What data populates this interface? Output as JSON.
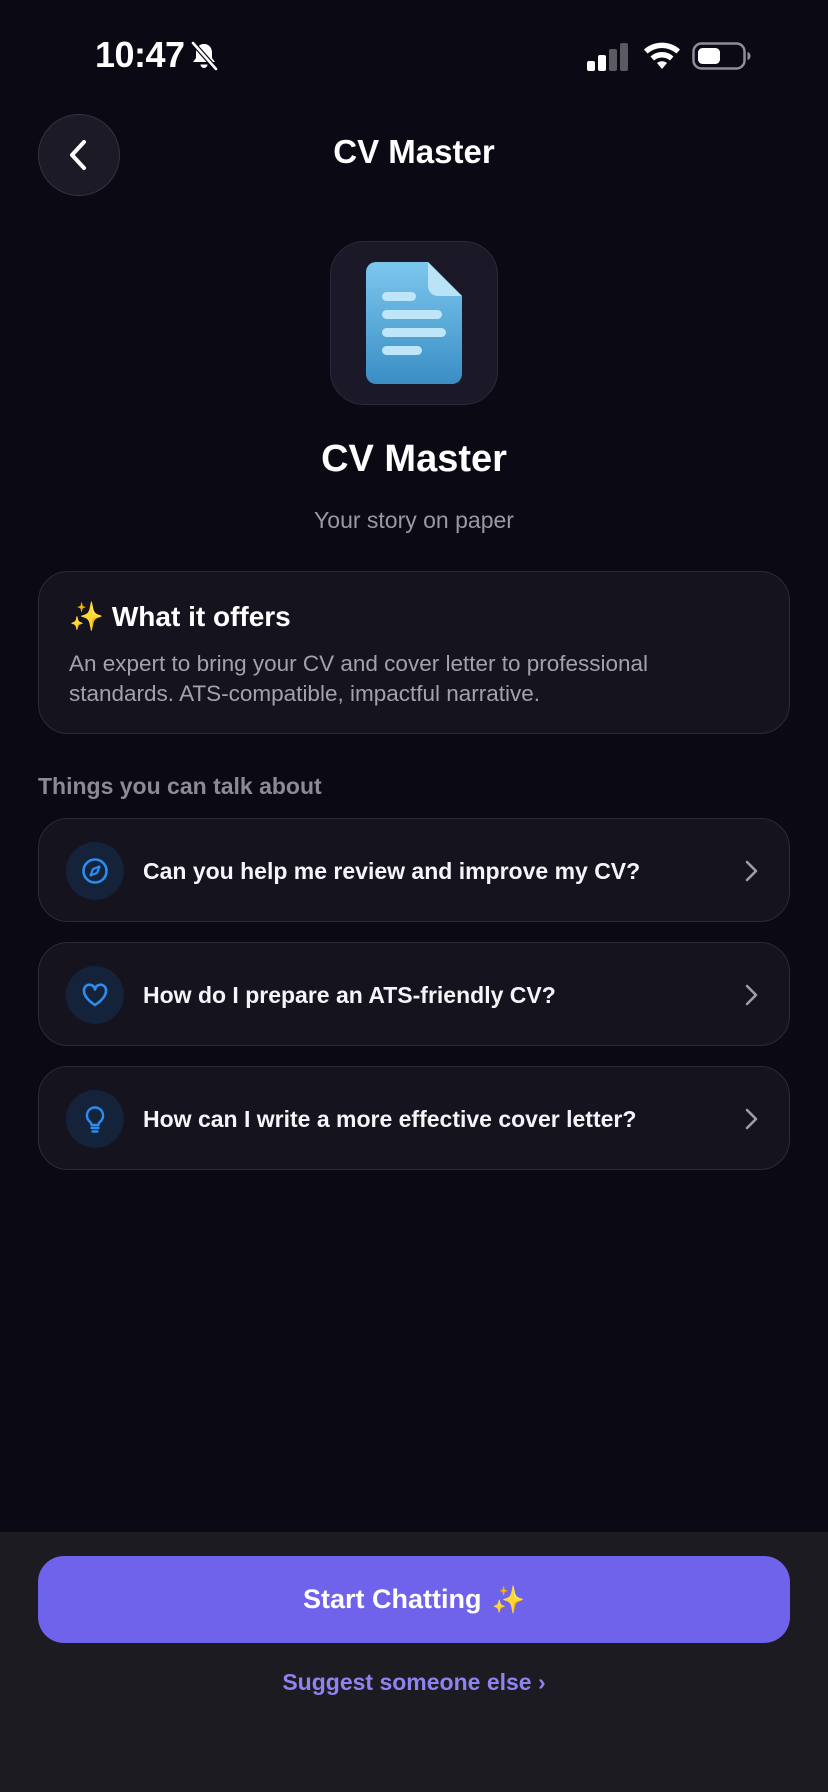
{
  "status_bar": {
    "time": "10:47",
    "icons": [
      "bell-slash-icon",
      "cellular-signal-icon",
      "wifi-icon",
      "battery-icon"
    ]
  },
  "header": {
    "title": "CV Master",
    "back_icon": "chevron-left-icon"
  },
  "profile": {
    "icon": "document-icon",
    "name": "CV Master",
    "tagline": "Your story on paper"
  },
  "offers": {
    "icon": "sparkles-icon",
    "title": "What it offers",
    "description": "An expert to bring your CV and cover letter to professional standards. ATS-compatible, impactful narrative."
  },
  "topics": {
    "label": "Things you can talk about",
    "items": [
      {
        "icon": "compass-icon",
        "text": "Can you help me review and improve my CV?"
      },
      {
        "icon": "heart-icon",
        "text": "How do I prepare an ATS-friendly CV?"
      },
      {
        "icon": "lightbulb-icon",
        "text": "How can I write a more effective cover letter?"
      }
    ]
  },
  "actions": {
    "start_label": "Start Chatting",
    "start_icon": "sparkles-icon",
    "suggest_label": "Suggest someone else ›"
  },
  "colors": {
    "background": "#0b0914",
    "card": "#15131e",
    "accent": "#6e63ea",
    "link": "#8e83f0",
    "topic_icon": "#2d8cf0"
  }
}
